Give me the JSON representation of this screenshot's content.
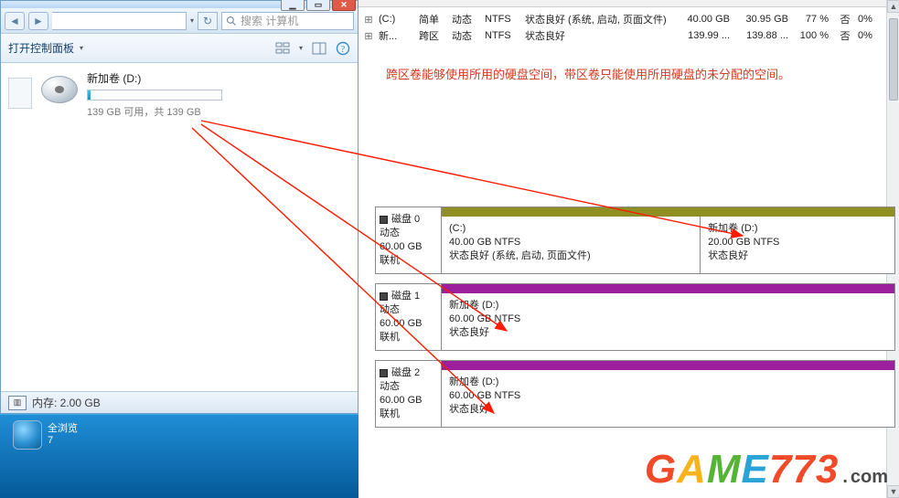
{
  "explorer": {
    "search_placeholder": "搜索 计算机",
    "toolbar_open": "打开控制面板",
    "drive_name": "新加卷 (D:)",
    "capacity_text": "139 GB 可用，共 139 GB",
    "status_memory": "内存: 2.00 GB"
  },
  "taskbar": {
    "item1_line1": "全浏览",
    "item1_line2": "7"
  },
  "dm": {
    "rows": [
      {
        "icon": "⊞",
        "vol": "(C:)",
        "layout": "简单",
        "type": "动态",
        "fs": "NTFS",
        "status": "状态良好 (系统, 启动, 页面文件)",
        "cap": "40.00 GB",
        "free": "30.95 GB",
        "pct": "77 %",
        "ft": "否",
        "oh": "0%"
      },
      {
        "icon": "⊞",
        "vol": "新...",
        "layout": "跨区",
        "type": "动态",
        "fs": "NTFS",
        "status": "状态良好",
        "cap": "139.99 ...",
        "free": "139.88 ...",
        "pct": "100 %",
        "ft": "否",
        "oh": "0%"
      }
    ],
    "annotation": "跨区卷能够使用所用的硬盘空间，带区卷只能使用所用硬盘的未分配的空间。",
    "disks": [
      {
        "label_title": "磁盘 0",
        "label_type": "动态",
        "label_cap": "60.00 GB",
        "label_state": "联机",
        "stripe_class": "olive",
        "parts": [
          {
            "title": "(C:)",
            "size": "40.00 GB NTFS",
            "status": "状态良好 (系统, 启动, 页面文件)",
            "cls": "part-c"
          },
          {
            "title": "新加卷  (D:)",
            "size": "20.00 GB NTFS",
            "status": "状态良好",
            "cls": "part-d"
          }
        ]
      },
      {
        "label_title": "磁盘 1",
        "label_type": "动态",
        "label_cap": "60.00 GB",
        "label_state": "联机",
        "stripe_class": "purple",
        "parts": [
          {
            "title": "新加卷  (D:)",
            "size": "60.00 GB NTFS",
            "status": "状态良好",
            "cls": "part-d"
          }
        ]
      },
      {
        "label_title": "磁盘 2",
        "label_type": "动态",
        "label_cap": "60.00 GB",
        "label_state": "联机",
        "stripe_class": "purple",
        "parts": [
          {
            "title": "新加卷  (D:)",
            "size": "60.00 GB NTFS",
            "status": "状态良好",
            "cls": "part-d"
          }
        ]
      }
    ]
  },
  "watermark": {
    "g": "G",
    "a": "A",
    "m": "M",
    "e": "E",
    "n773": "773",
    "dot": ".",
    "com": "com"
  }
}
